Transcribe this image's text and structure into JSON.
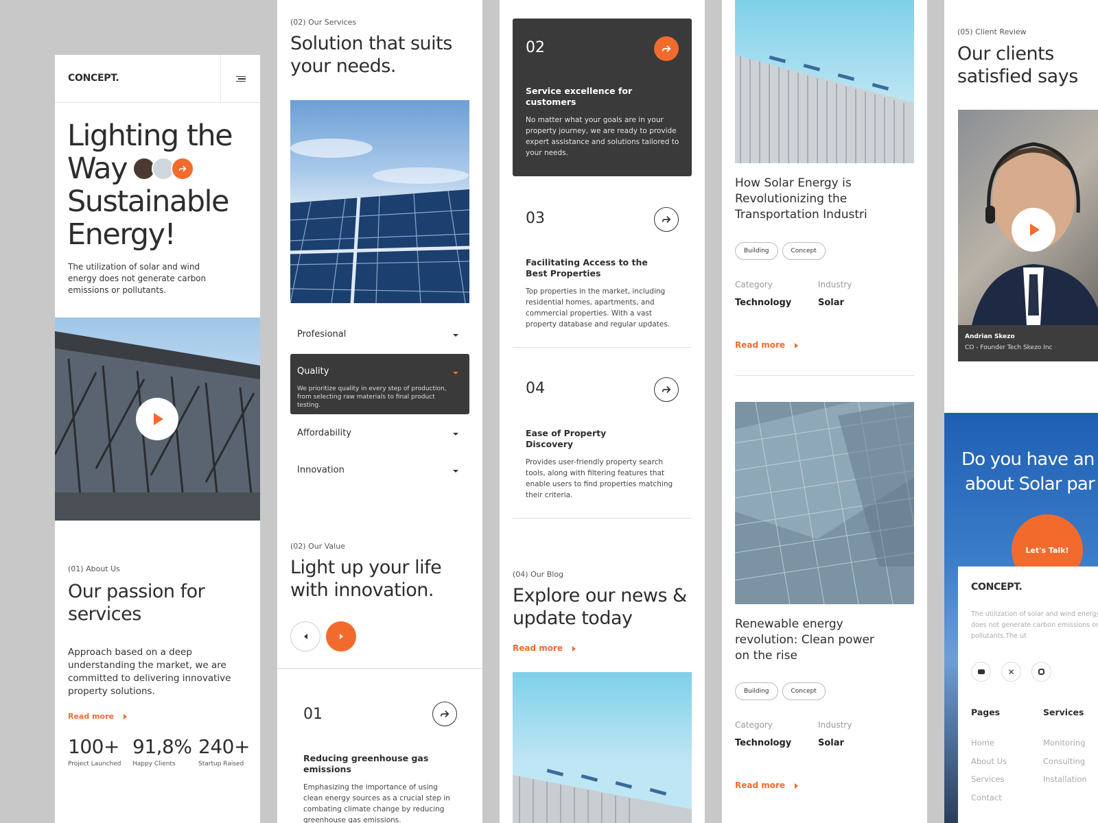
{
  "brand": {
    "logo": "CONCEPT."
  },
  "hero": {
    "title_line1": "Lighting the",
    "title_line2": "Way",
    "title_line3": "Sustainable",
    "title_line4": "Energy!",
    "description": "The utilization of solar and wind energy does not generate carbon emissions or pollutants."
  },
  "about": {
    "label": "(01) About Us",
    "title": "Our passion for services",
    "description": "Approach based on a deep understanding the market, we are committed to delivering innovative property solutions.",
    "read_more": "Read more",
    "stats": [
      {
        "value": "100+",
        "label": "Project Launched"
      },
      {
        "value": "91,8%",
        "label": "Happy Clients"
      },
      {
        "value": "240+",
        "label": "Startup Raised"
      }
    ]
  },
  "services": {
    "label": "(02) Our Services",
    "title": "Solution that suits your needs.",
    "accordion": [
      {
        "title": "Profesional"
      },
      {
        "title": "Quality",
        "body": "We prioritize quality in every step of production, from selecting raw materials to final product testing."
      },
      {
        "title": "Affordability"
      },
      {
        "title": "Innovation"
      }
    ]
  },
  "value": {
    "label": "(02) Our Value",
    "title": "Light up your life with innovation.",
    "cards": [
      {
        "num": "01",
        "title": "Reducing greenhouse gas emissions",
        "text": "Emphasizing the importance of using clean energy sources as a crucial step in combating climate change by reducing greenhouse gas emissions."
      },
      {
        "num": "02",
        "title": "Service excellence for customers",
        "text": "No matter what your goals are in your property journey, we are ready to provide expert assistance and solutions tailored to your needs."
      },
      {
        "num": "03",
        "title": "Facilitating Access to the Best Properties",
        "text": "Top properties in the market, including residential homes, apartments, and commercial properties. With a vast property database and regular updates."
      },
      {
        "num": "04",
        "title": "Ease of Property Discovery",
        "text": "Provides user-friendly property search tools, along with filtering features that enable users to find properties matching their criteria."
      }
    ]
  },
  "blog": {
    "label": "(04) Our Blog",
    "title": "Explore our news & update today",
    "read_more": "Read more",
    "posts": [
      {
        "title": "How Solar Energy is Revolutionizing the Transportation Industri",
        "tags": [
          "Building",
          "Concept"
        ],
        "category_label": "Category",
        "category": "Technology",
        "industry_label": "Industry",
        "industry": "Solar",
        "read_more": "Read more"
      },
      {
        "title": "Renewable energy revolution: Clean power on the rise",
        "tags": [
          "Building",
          "Concept"
        ],
        "category_label": "Category",
        "category": "Technology",
        "industry_label": "Industry",
        "industry": "Solar",
        "read_more": "Read more"
      }
    ]
  },
  "review": {
    "label": "(05) Client Review",
    "title": "Our clients satisfied says",
    "name": "Andrian Skezo",
    "role": "CO - Founder Tech Skezo Inc"
  },
  "cta": {
    "title_line1": "Do you have an i",
    "title_line2": "about Solar par",
    "button": "Let's Talk!"
  },
  "footer": {
    "logo": "CONCEPT.",
    "description": "The utilization of solar and wind energy does not generate carbon emissions or pollutants.The ut",
    "pages_heading": "Pages",
    "pages": [
      "Home",
      "About Us",
      "Services",
      "Contact"
    ],
    "services_heading": "Services",
    "services": [
      "Monitoring",
      "Consulting",
      "Installation"
    ]
  },
  "colors": {
    "accent": "#f26b2d",
    "dark": "#3a3a3a",
    "page_bg": "#c8c8c8"
  }
}
